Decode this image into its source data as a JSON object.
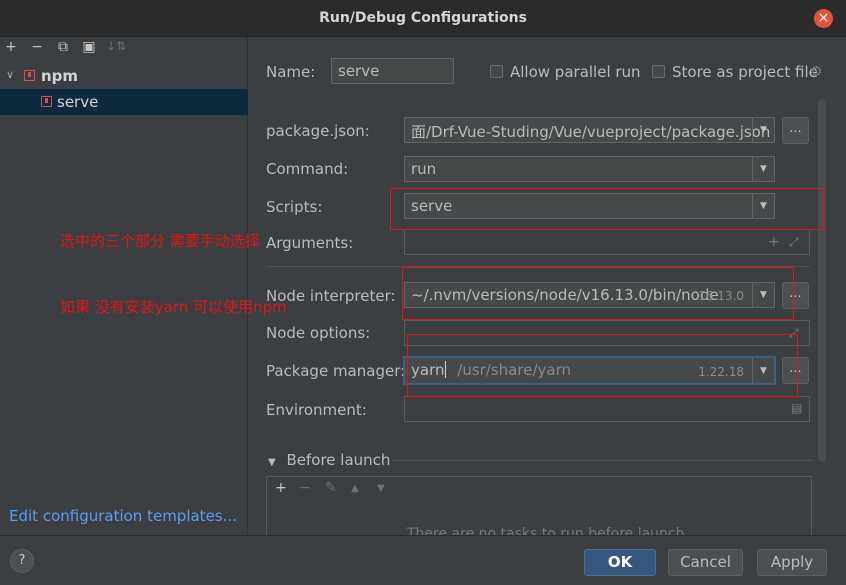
{
  "window": {
    "title": "Run/Debug Configurations"
  },
  "icons": {
    "close": "close-icon",
    "add": "plus-icon",
    "remove": "minus-icon",
    "copy": "copy-icon",
    "folder": "new-folder-icon",
    "sort": "sort-icon",
    "settings": "gear-icon",
    "expand": "expand-icon",
    "help": "question-icon",
    "note": "note-icon"
  },
  "toolbar": {
    "add": "+",
    "remove": "−",
    "copy": "⧉",
    "folder": "▣",
    "sort": "↓⇅"
  },
  "tree": {
    "arrow": "∨",
    "group_label": "npm",
    "item_label": "serve"
  },
  "edit_templates_link": "Edit configuration templates...",
  "form": {
    "name_label": "Name:",
    "name_value": "serve",
    "allow_parallel_label": "Allow parallel run",
    "store_project_label": "Store as project file",
    "package_json_label": "package.json:",
    "package_json_value": "面/Drf-Vue-Studing/Vue/vueproject/package.json",
    "command_label": "Command:",
    "command_value": "run",
    "scripts_label": "Scripts:",
    "scripts_value": "serve",
    "arguments_label": "Arguments:",
    "arguments_value": "",
    "node_interpreter_label": "Node interpreter:",
    "node_interpreter_value": "~/.nvm/versions/node/v16.13.0/bin/node",
    "node_version": "16.13.0",
    "node_options_label": "Node options:",
    "package_manager_label": "Package manager:",
    "package_manager_value": "yarn",
    "package_manager_path": "/usr/share/yarn",
    "package_manager_version": "1.22.18",
    "environment_label": "Environment:",
    "ellipsis": "...",
    "dropdown_arrow": "▼",
    "plus": "+",
    "expand": "⤢"
  },
  "before_launch": {
    "toggle": "▼",
    "title": "Before launch",
    "add": "+",
    "remove": "−",
    "edit": "✎",
    "up": "▲",
    "down": "▼",
    "empty_text": "There are no tasks to run before launch"
  },
  "buttons": {
    "help": "?",
    "ok": "OK",
    "cancel": "Cancel",
    "apply": "Apply"
  },
  "annotations": {
    "note1": "选中的三个部分 需要手动选择",
    "note2": "如果 没有安装yarn 可以使用npm",
    "color": "#e0161c"
  }
}
